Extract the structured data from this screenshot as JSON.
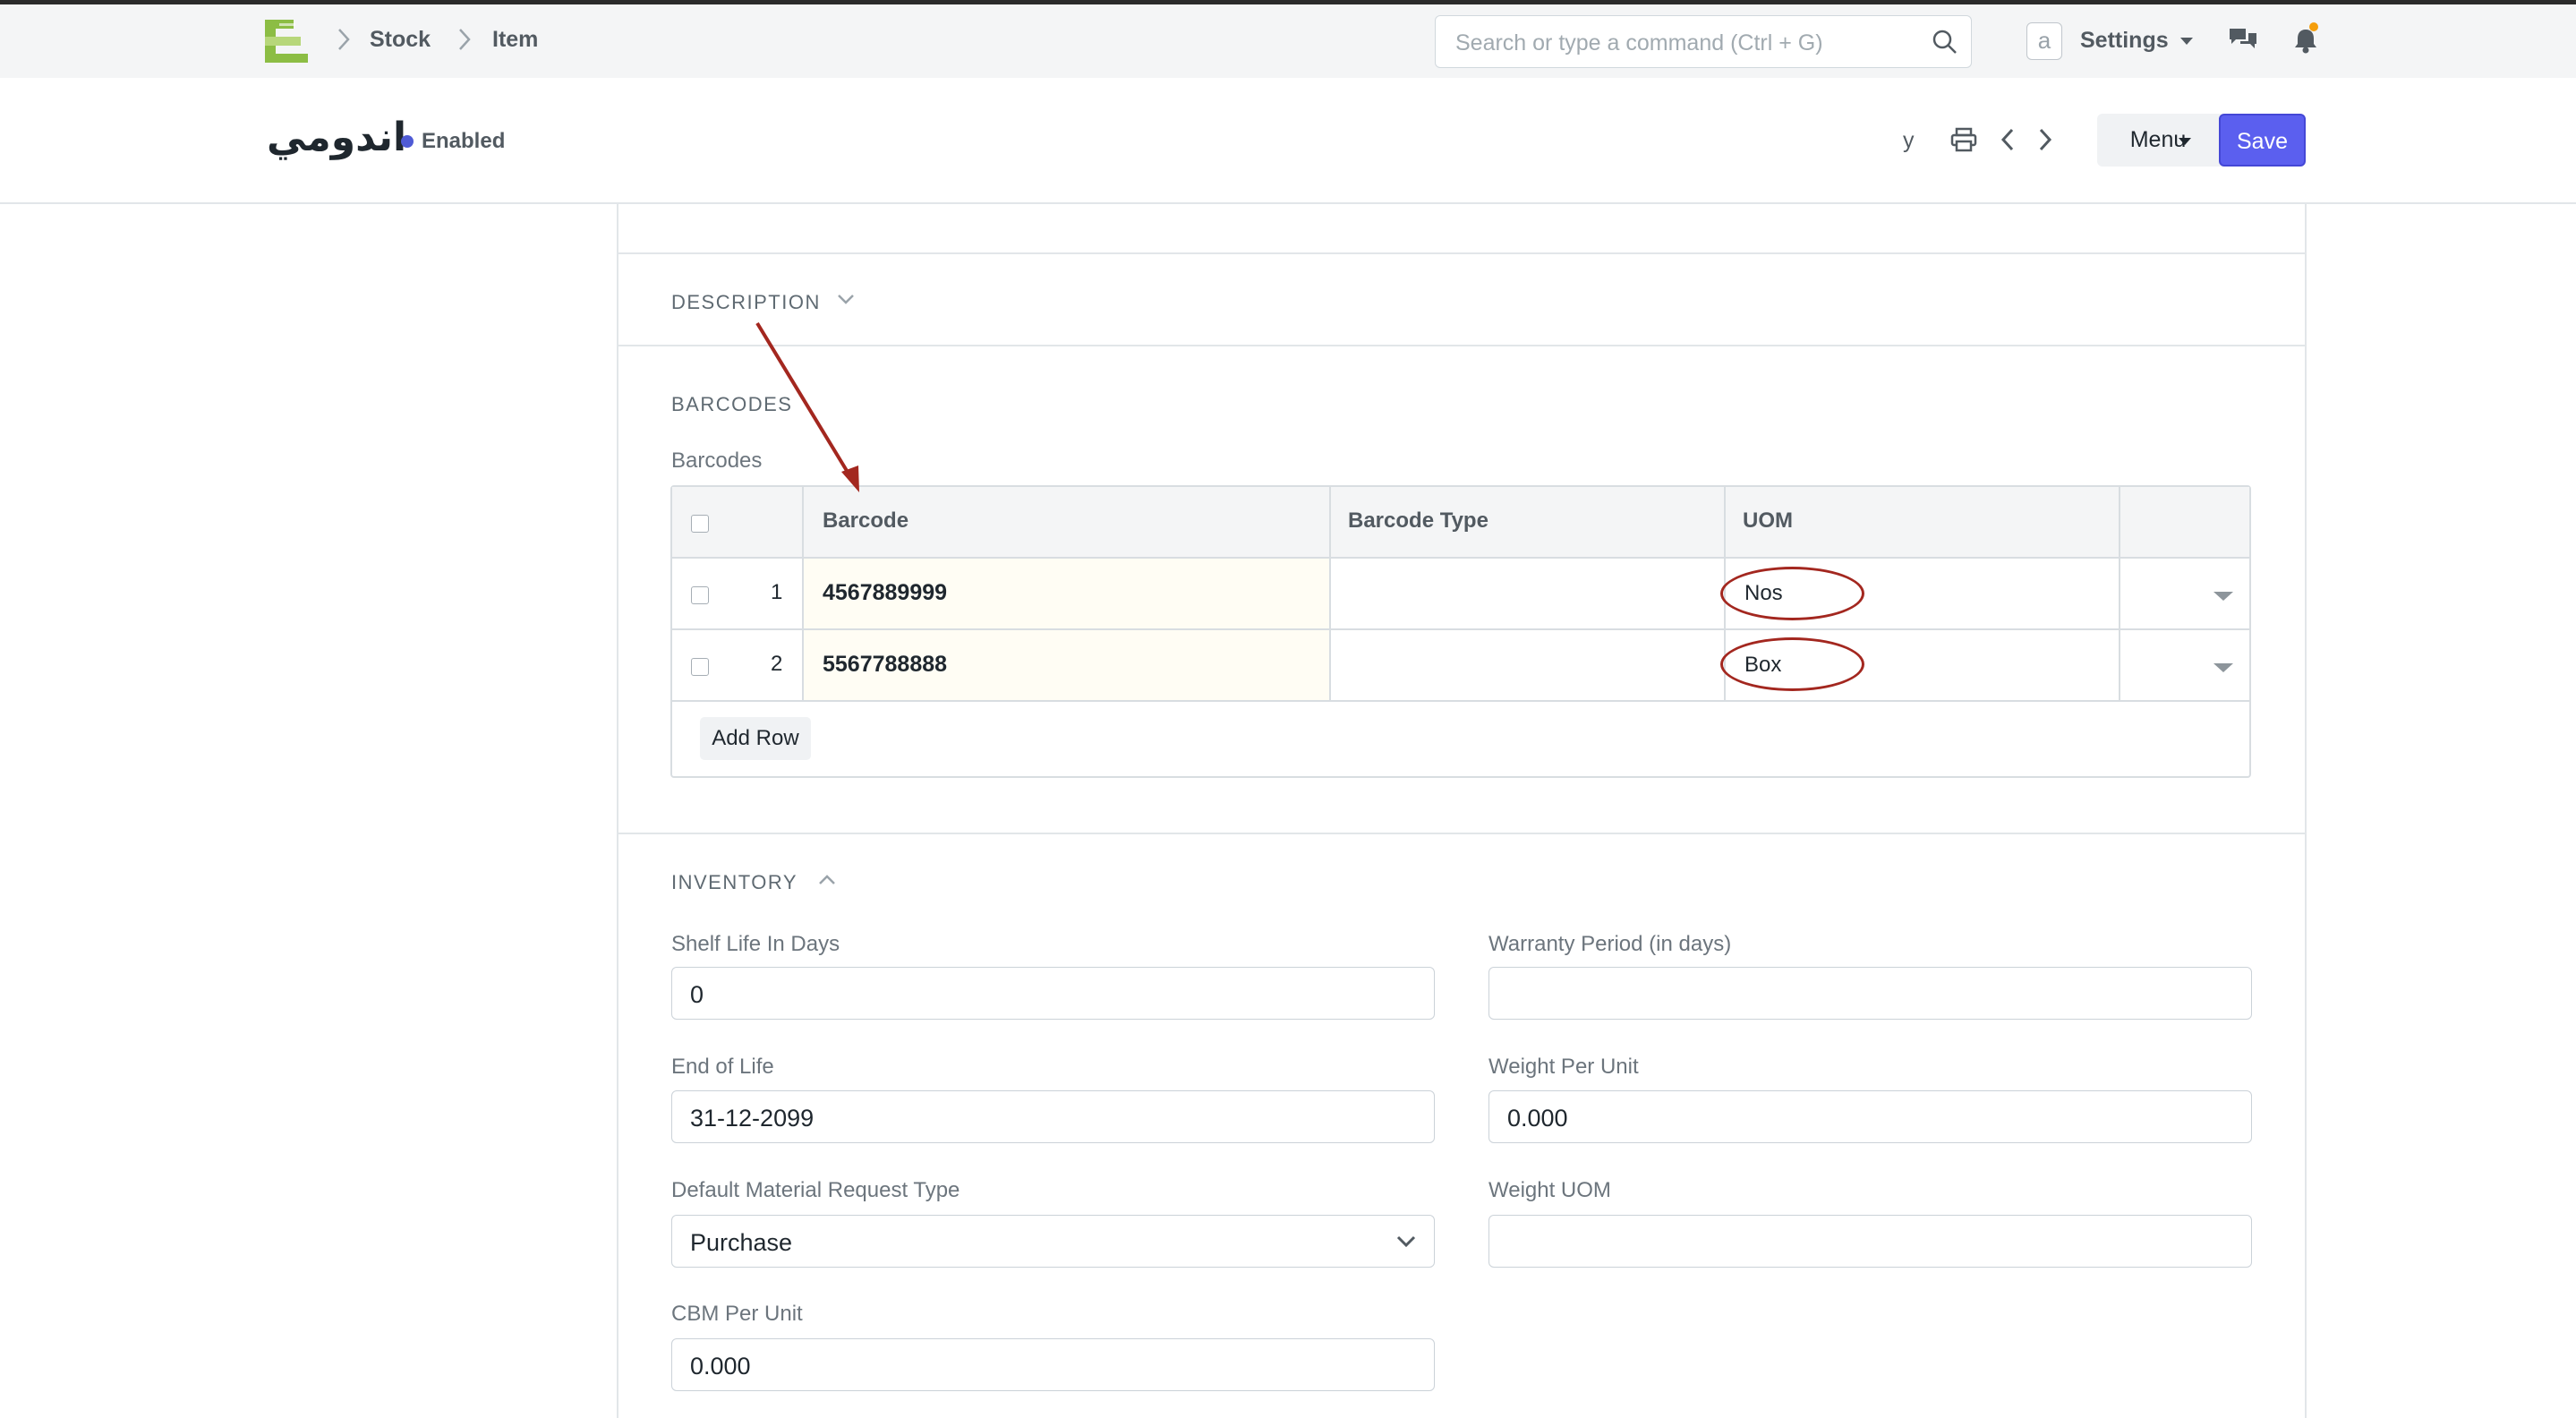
{
  "breadcrumbs": [
    "Stock",
    "Item"
  ],
  "search": {
    "placeholder": "Search or type a command (Ctrl + G)"
  },
  "user": {
    "avatar_letter": "a",
    "settings_label": "Settings",
    "short_name": "y"
  },
  "page": {
    "title": "اندومي",
    "status": "Enabled",
    "menu_label": "Menu",
    "save_label": "Save"
  },
  "sections": {
    "description": "DESCRIPTION",
    "barcodes": "BARCODES",
    "inventory": "INVENTORY"
  },
  "barcodes": {
    "label": "Barcodes",
    "columns": [
      "Barcode",
      "Barcode Type",
      "UOM"
    ],
    "rows": [
      {
        "idx": "1",
        "barcode": "4567889999",
        "type": "",
        "uom": "Nos"
      },
      {
        "idx": "2",
        "barcode": "5567788888",
        "type": "",
        "uom": "Box"
      }
    ],
    "add_row": "Add Row"
  },
  "inventory": {
    "shelf_life": {
      "label": "Shelf Life In Days",
      "value": "0"
    },
    "warranty": {
      "label": "Warranty Period (in days)",
      "value": ""
    },
    "end_of_life": {
      "label": "End of Life",
      "value": "31-12-2099"
    },
    "weight_per_unit": {
      "label": "Weight Per Unit",
      "value": "0.000"
    },
    "material_request": {
      "label": "Default Material Request Type",
      "value": "Purchase"
    },
    "weight_uom": {
      "label": "Weight UOM",
      "value": ""
    },
    "cbm": {
      "label": "CBM Per Unit",
      "value": "0.000"
    }
  },
  "colors": {
    "primary": "#5b5fef",
    "annotation": "#a3271f",
    "notification": "#f59e0b"
  }
}
